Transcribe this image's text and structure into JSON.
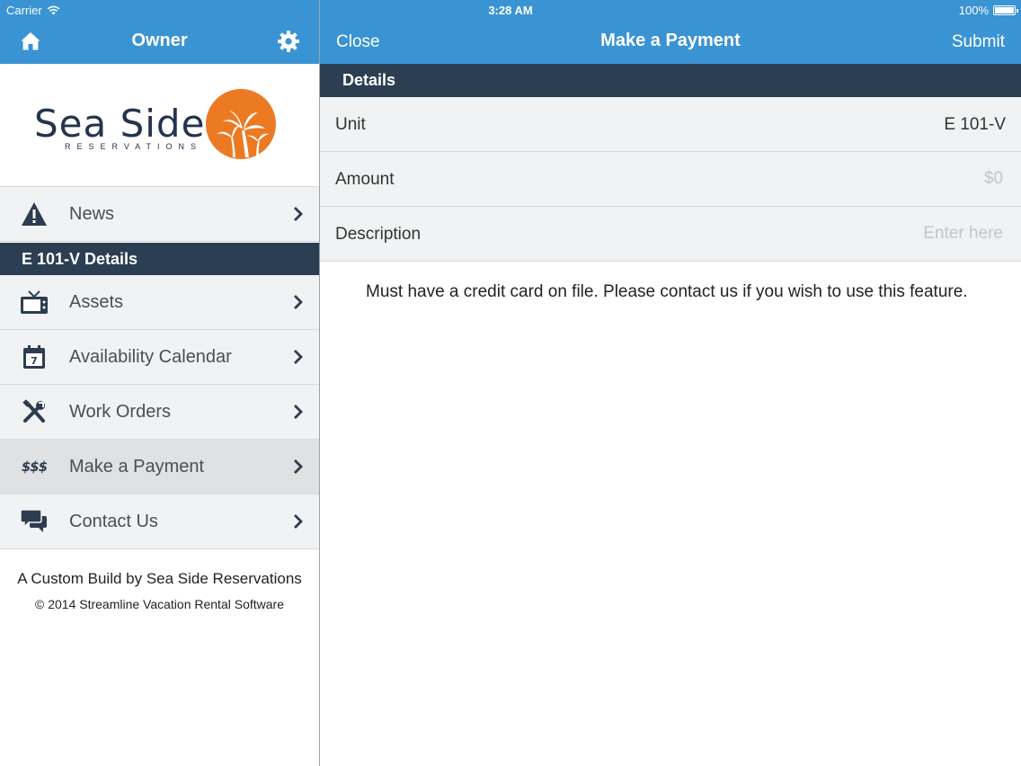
{
  "status": {
    "carrier": "Carrier",
    "time": "3:28 AM",
    "battery": "100%"
  },
  "left_nav": {
    "title": "Owner"
  },
  "right_nav": {
    "close_label": "Close",
    "title": "Make a Payment",
    "submit_label": "Submit"
  },
  "logo": {
    "name": "Sea Side",
    "subtitle": "RESERVATIONS"
  },
  "menu": {
    "news": {
      "label": "News",
      "icon": "warning-icon"
    },
    "section_title": "E 101-V Details",
    "items": [
      {
        "label": "Assets",
        "icon": "tv-icon"
      },
      {
        "label": "Availability Calendar",
        "icon": "calendar-icon",
        "icon_text": "7"
      },
      {
        "label": "Work Orders",
        "icon": "tools-icon"
      },
      {
        "label": "Make a Payment",
        "icon": "money-icon",
        "icon_text": "$$$",
        "active": true
      },
      {
        "label": "Contact Us",
        "icon": "chat-icon"
      }
    ]
  },
  "footer": {
    "line1": "A Custom Build by Sea Side Reservations",
    "line2": "© 2014 Streamline Vacation Rental Software"
  },
  "form": {
    "section_title": "Details",
    "unit_label": "Unit",
    "unit_value": "E 101-V",
    "amount_label": "Amount",
    "amount_placeholder": "$0",
    "description_label": "Description",
    "description_placeholder": "Enter here",
    "notice": "Must have a credit card on file. Please contact us if you wish to use this feature."
  },
  "colors": {
    "accent": "#3a93d3",
    "header_dark": "#2c3e52",
    "logo_orange": "#ec7a23",
    "row_bg": "#f0f2f3"
  }
}
